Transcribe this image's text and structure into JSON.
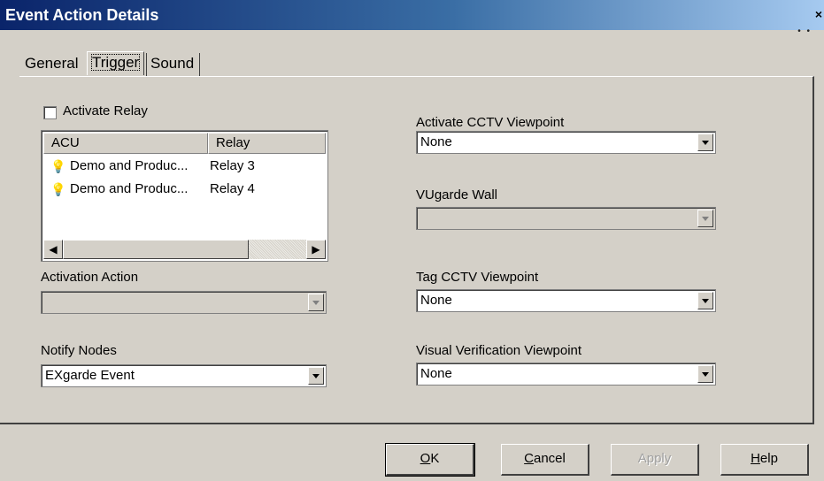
{
  "window": {
    "title": "Event Action Details",
    "close_glyph": "×",
    "dots": "• •"
  },
  "tabs": [
    {
      "label": "General"
    },
    {
      "label": "Trigger"
    },
    {
      "label": "Sound"
    }
  ],
  "left": {
    "activate_relay_label": "Activate Relay",
    "activate_relay_checked": false,
    "list": {
      "columns": [
        "ACU",
        "Relay"
      ],
      "rows": [
        {
          "acu": "Demo and Produc...",
          "relay": "Relay 3",
          "icon": "lightbulb-icon"
        },
        {
          "acu": "Demo and Produc...",
          "relay": "Relay 4",
          "icon": "lightbulb-icon"
        }
      ]
    },
    "activation_action_label": "Activation Action",
    "activation_action_value": "",
    "notify_nodes_label": "Notify Nodes",
    "notify_nodes_value": "EXgarde Event"
  },
  "right": {
    "activate_cctv_label": "Activate CCTV Viewpoint",
    "activate_cctv_value": "None",
    "vugarde_wall_label": "VUgarde Wall",
    "vugarde_wall_value": "",
    "tag_cctv_label": "Tag CCTV Viewpoint",
    "tag_cctv_value": "None",
    "visual_verification_label": "Visual Verification Viewpoint",
    "visual_verification_value": "None"
  },
  "buttons": {
    "ok_accel": "O",
    "ok_rest": "K",
    "cancel_accel": "C",
    "cancel_rest": "ancel",
    "apply_label": "Apply",
    "help_accel": "H",
    "help_rest": "elp"
  },
  "colors": {
    "title_start": "#0a246a",
    "title_end": "#a6caf0",
    "face": "#d4d0c8"
  }
}
